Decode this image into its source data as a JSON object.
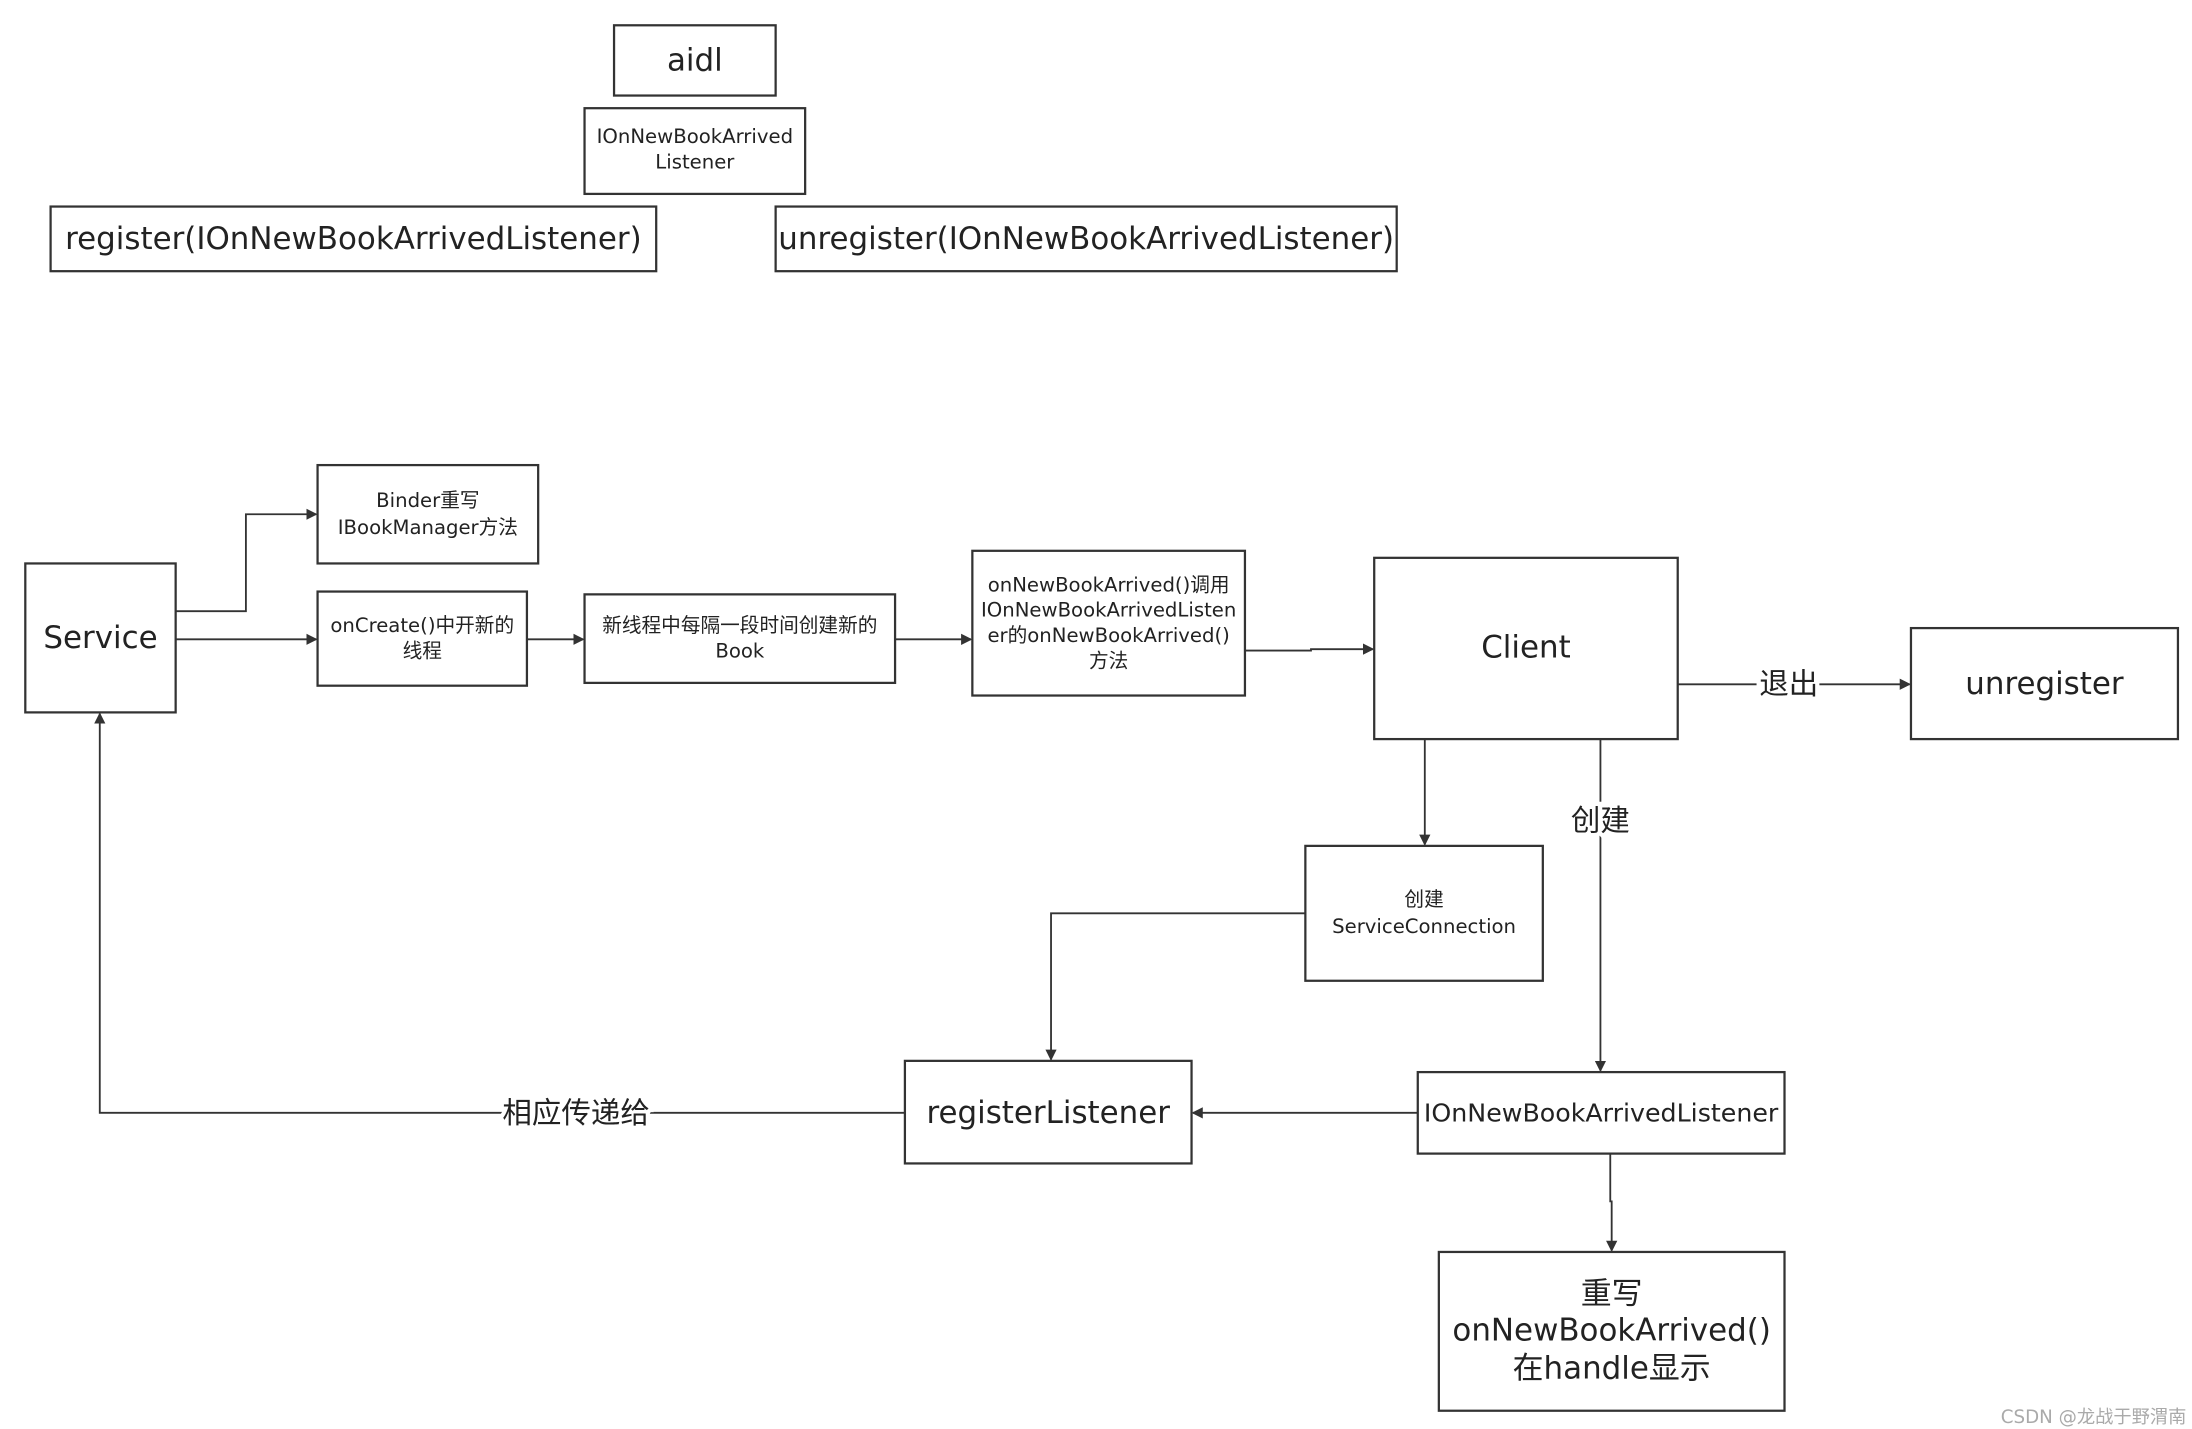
{
  "top": {
    "aidl": "aidl",
    "listener": [
      "IOnNewBookArrived",
      "Listener"
    ],
    "register": "register(IOnNewBookArrivedListener)",
    "unregister": "unregister(IOnNewBookArrivedListener)"
  },
  "flow": {
    "binder": [
      "Binder重写",
      "IBookManager方法"
    ],
    "service": "Service",
    "oncreate": [
      "onCreate()中开新的",
      "线程"
    ],
    "thread": [
      "新线程中每隔一段时间创建新的",
      "Book"
    ],
    "callback": [
      "onNewBookArrived()调用",
      "IOnNewBookArrivedListen",
      "er的onNewBookArrived()",
      "方法"
    ],
    "client": "Client",
    "unregister": "unregister",
    "service_connection": [
      "创建",
      "ServiceConnection"
    ],
    "register_listener": "registerListener",
    "listener": "IOnNewBookArrivedListener",
    "override": [
      "重写",
      "onNewBookArrived()",
      "在handle显示"
    ]
  },
  "edge_labels": {
    "exit": "退出",
    "create": "创建",
    "pass_to": "相应传递给"
  },
  "watermark": "CSDN @龙战于野渭南"
}
